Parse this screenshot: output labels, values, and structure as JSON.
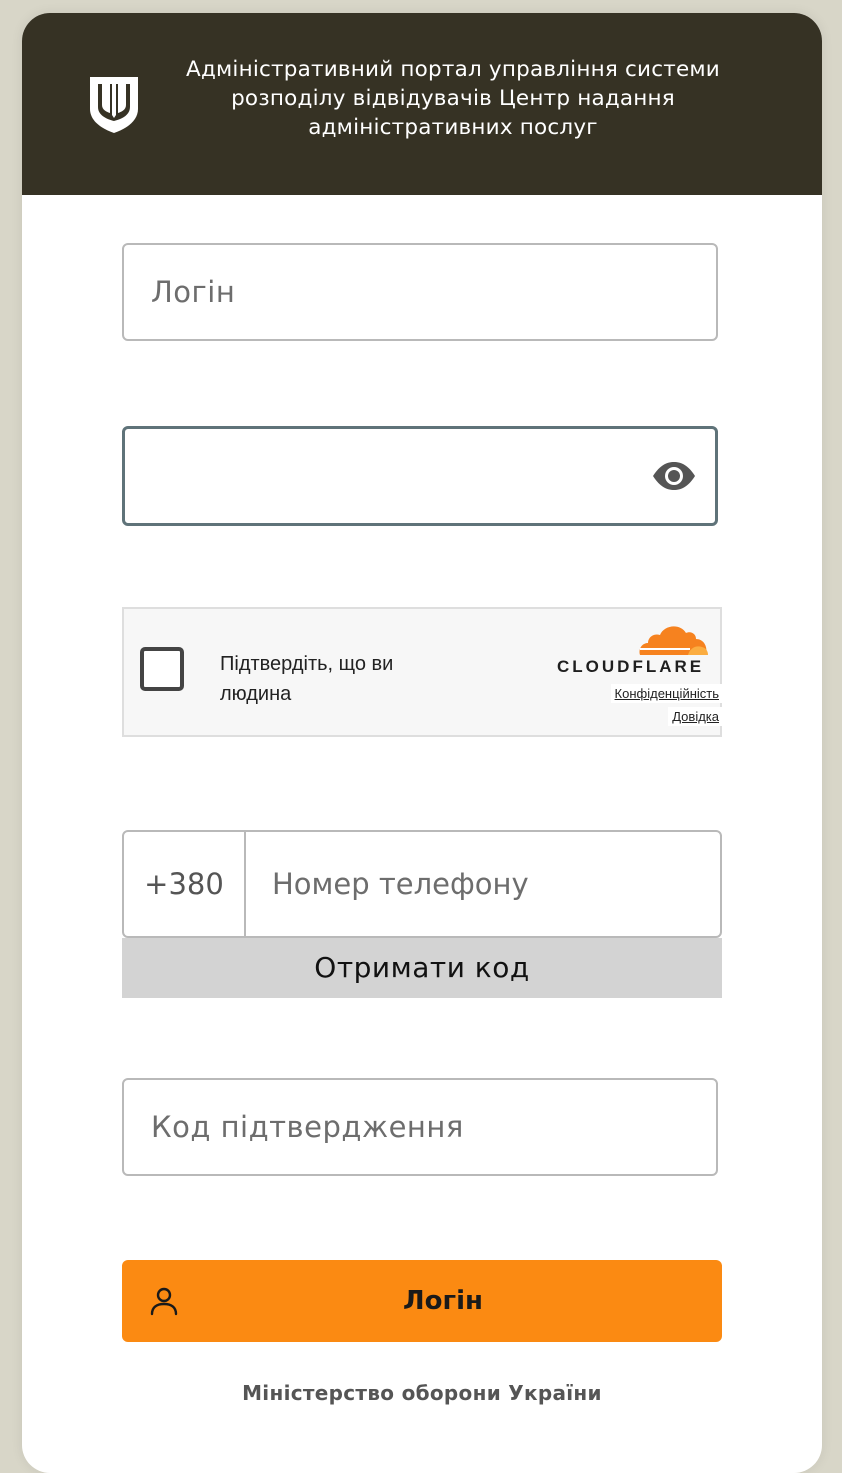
{
  "header": {
    "title": "Адміністративний портал управління системи розподілу відвідувачів Центр надання адміністративних послуг",
    "logo_icon": "trident-shield-icon",
    "background": "#363224"
  },
  "form": {
    "login_placeholder": "Логін",
    "password_value": "",
    "password_toggle_icon": "eye-icon",
    "captcha": {
      "label": "Підтвердіть, що ви людина",
      "provider": "CLOUDFLARE",
      "privacy_link": "Конфіденційність",
      "help_link": "Довідка"
    },
    "phone": {
      "prefix": "+380",
      "placeholder": "Номер телефону"
    },
    "get_code_label": "Отримати код",
    "code_placeholder": "Код підтвердження",
    "login_button_label": "Логін",
    "login_button_icon": "user-icon",
    "accent_color": "#fb8a12"
  },
  "footer": {
    "text": "Міністерство оборони України"
  }
}
